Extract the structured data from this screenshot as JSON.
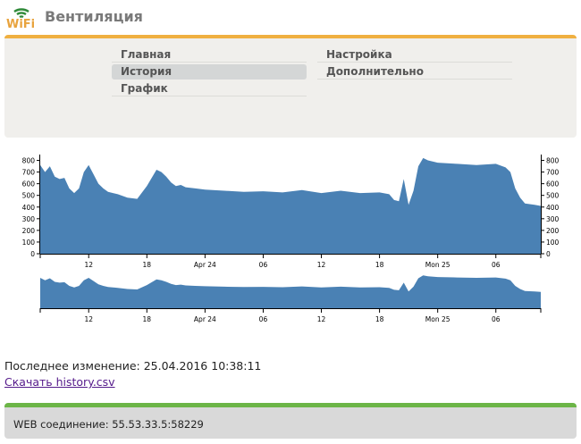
{
  "header": {
    "title": "Вентиляция",
    "logo_text": "WiFi",
    "logo_icon": "wifi-icon",
    "logo_color": "#e8a33d"
  },
  "menu": {
    "items": [
      {
        "label": "Главная",
        "active": false
      },
      {
        "label": "История",
        "active": true
      },
      {
        "label": "График",
        "active": false
      },
      {
        "label": "Настройка",
        "active": false
      },
      {
        "label": "Дополнительно",
        "active": false
      }
    ]
  },
  "chart_data": [
    {
      "type": "area",
      "title": "",
      "xlabel": "",
      "ylabel": "",
      "ylim": [
        0,
        850
      ],
      "y_ticks": [
        0,
        100,
        200,
        300,
        400,
        500,
        600,
        700,
        800
      ],
      "x_ticks": [
        "12",
        "18",
        "Apr 24",
        "06",
        "12",
        "18",
        "Mon 25",
        "06"
      ],
      "x_range": [
        "2016-04-23 07:00",
        "2016-04-25 10:38"
      ],
      "grid": false,
      "color": "#4a81b4",
      "series": [
        {
          "x": [
            "2016-04-23 07:00",
            "2016-04-23 07:30",
            "2016-04-23 08:00",
            "2016-04-23 08:30",
            "2016-04-23 09:00",
            "2016-04-23 09:30",
            "2016-04-23 10:00",
            "2016-04-23 10:30",
            "2016-04-23 11:00",
            "2016-04-23 11:30",
            "2016-04-23 12:00",
            "2016-04-23 12:30",
            "2016-04-23 13:00",
            "2016-04-23 13:30",
            "2016-04-23 14:00",
            "2016-04-23 15:00",
            "2016-04-23 16:00",
            "2016-04-23 17:00",
            "2016-04-23 18:00",
            "2016-04-23 19:00",
            "2016-04-23 19:30",
            "2016-04-23 20:00",
            "2016-04-23 20:30",
            "2016-04-23 21:00",
            "2016-04-23 21:30",
            "2016-04-23 22:00",
            "2016-04-23 23:00",
            "2016-04-24 00:00",
            "2016-04-24 02:00",
            "2016-04-24 04:00",
            "2016-04-24 06:00",
            "2016-04-24 08:00",
            "2016-04-24 10:00",
            "2016-04-24 12:00",
            "2016-04-24 14:00",
            "2016-04-24 16:00",
            "2016-04-24 18:00",
            "2016-04-24 19:00",
            "2016-04-24 19:30",
            "2016-04-24 20:00",
            "2016-04-24 20:30",
            "2016-04-24 21:00",
            "2016-04-24 21:30",
            "2016-04-24 22:00",
            "2016-04-24 22:30",
            "2016-04-24 23:00",
            "2016-04-25 00:00",
            "2016-04-25 02:00",
            "2016-04-25 04:00",
            "2016-04-25 06:00",
            "2016-04-25 07:00",
            "2016-04-25 07:30",
            "2016-04-25 08:00",
            "2016-04-25 08:30",
            "2016-04-25 09:00",
            "2016-04-25 10:00",
            "2016-04-25 10:38"
          ],
          "y": [
            760,
            700,
            750,
            660,
            640,
            650,
            560,
            520,
            560,
            700,
            760,
            680,
            600,
            560,
            530,
            510,
            480,
            470,
            580,
            720,
            700,
            660,
            610,
            580,
            590,
            570,
            560,
            550,
            540,
            530,
            535,
            525,
            545,
            520,
            540,
            520,
            525,
            510,
            460,
            450,
            640,
            420,
            540,
            750,
            820,
            800,
            780,
            770,
            760,
            770,
            740,
            700,
            560,
            480,
            430,
            420,
            410
          ]
        }
      ]
    },
    {
      "type": "area",
      "title": "",
      "xlabel": "",
      "ylabel": "",
      "ylim": [
        0,
        850
      ],
      "x_ticks": [
        "12",
        "18",
        "Apr 24",
        "06",
        "12",
        "18",
        "Mon 25",
        "06"
      ],
      "x_range": [
        "2016-04-23 07:00",
        "2016-04-25 10:38"
      ],
      "color": "#4a81b4",
      "note_series": "same data as main chart"
    }
  ],
  "info": {
    "last_change": "Последнее изменение: 25.04.2016 10:38:11",
    "download_link": "Скачать history.csv"
  },
  "status": {
    "text": "WEB соединение: 55.53.33.5:58229",
    "accent_color": "#6cb547"
  },
  "colors": {
    "menu_accent": "#f0b041",
    "menu_bg": "#f0efec",
    "active_item_bg": "#d4d6d6",
    "chart_fill": "#4a81b4"
  }
}
